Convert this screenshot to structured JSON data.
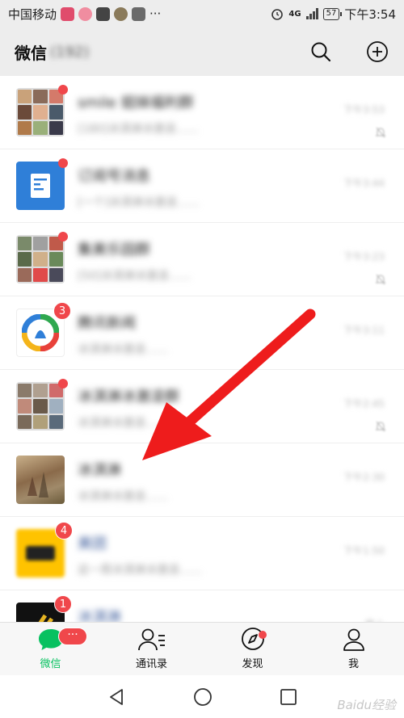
{
  "status_bar": {
    "carrier": "中国移动",
    "network": "4G",
    "battery": "57",
    "time": "下午3:54",
    "more": "···"
  },
  "header": {
    "title": "微信",
    "subtitle": "(192)"
  },
  "chats": [
    {
      "name": "smile 姐妹福利群",
      "preview": "[180]冰淇淋冰激凌……",
      "time": "下午3:53",
      "badge": "",
      "unread_dot": true,
      "muted": true
    },
    {
      "name": "订阅号消息",
      "preview": "[一个]冰淇淋冰激凌……",
      "time": "下午3:44",
      "badge": "",
      "unread_dot": true,
      "muted": false
    },
    {
      "name": "集美乐园群",
      "preview": "[50]冰淇淋冰激凌……",
      "time": "下午3:23",
      "badge": "",
      "unread_dot": true,
      "muted": true
    },
    {
      "name": "腾讯新闻",
      "preview": "冰淇淋冰激凌……",
      "time": "下午3:11",
      "badge": "3",
      "unread_dot": false,
      "muted": false
    },
    {
      "name": "冰淇淋冰激凌群",
      "preview": "冰淇淋冰激凌……",
      "time": "下午2:45",
      "badge": "",
      "unread_dot": true,
      "muted": true
    },
    {
      "name": "冰淇淋",
      "preview": "冰淇淋冰激凌……",
      "time": "下午2:30",
      "badge": "",
      "unread_dot": false,
      "muted": false
    },
    {
      "name": "美团",
      "preview": "这一周冰淇淋冰激凌……",
      "time": "下午1:50",
      "badge": "4",
      "unread_dot": false,
      "muted": false
    },
    {
      "name": "冰淇淋",
      "preview": "",
      "time": "晚上",
      "badge": "1",
      "unread_dot": false,
      "muted": false
    }
  ],
  "tabs": [
    {
      "label": "微信",
      "badge": "···"
    },
    {
      "label": "通讯录"
    },
    {
      "label": "发现"
    },
    {
      "label": "我"
    }
  ],
  "watermark": "Baidu经验",
  "colors": {
    "accent": "#07c160",
    "badge": "#f0474b",
    "arrow": "#ee1c1c"
  }
}
